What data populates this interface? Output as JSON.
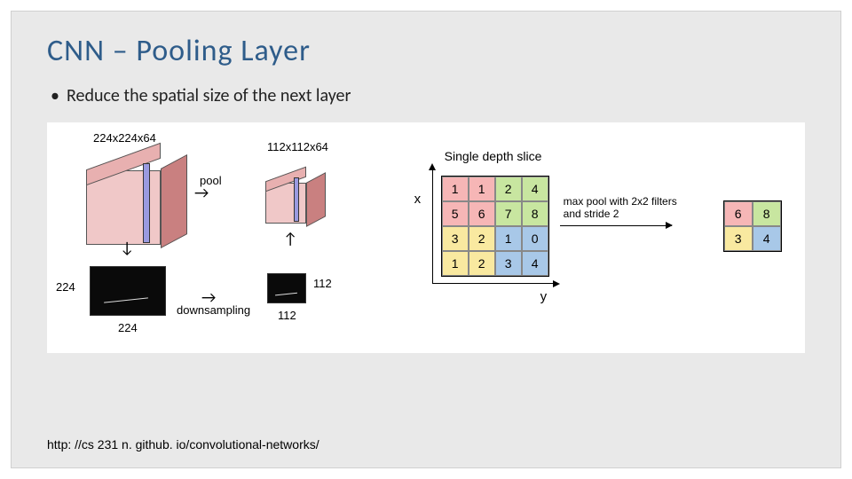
{
  "slide": {
    "title": "CNN – Pooling Layer",
    "bullet": "Reduce the spatial size of the next layer",
    "credit": "http: //cs 231 n. github. io/convolutional-networks/"
  },
  "figA": {
    "dim_in": "224x224x64",
    "dim_out": "112x112x64",
    "op": "pool",
    "downsampling": "downsampling",
    "in_hw": "224",
    "out_hw": "112"
  },
  "figB": {
    "title": "Single depth slice",
    "x_label": "x",
    "y_label": "y",
    "caption1": "max pool with 2x2 filters",
    "caption2": "and stride 2",
    "input": [
      [
        "1",
        "1",
        "2",
        "4"
      ],
      [
        "5",
        "6",
        "7",
        "8"
      ],
      [
        "3",
        "2",
        "1",
        "0"
      ],
      [
        "1",
        "2",
        "3",
        "4"
      ]
    ],
    "input_colors": [
      [
        "r",
        "r",
        "g",
        "g"
      ],
      [
        "r",
        "r",
        "g",
        "g"
      ],
      [
        "y",
        "y",
        "b",
        "b"
      ],
      [
        "y",
        "y",
        "b",
        "b"
      ]
    ],
    "output": [
      [
        "6",
        "8"
      ],
      [
        "3",
        "4"
      ]
    ],
    "output_colors": [
      [
        "r",
        "g"
      ],
      [
        "y",
        "b"
      ]
    ]
  }
}
